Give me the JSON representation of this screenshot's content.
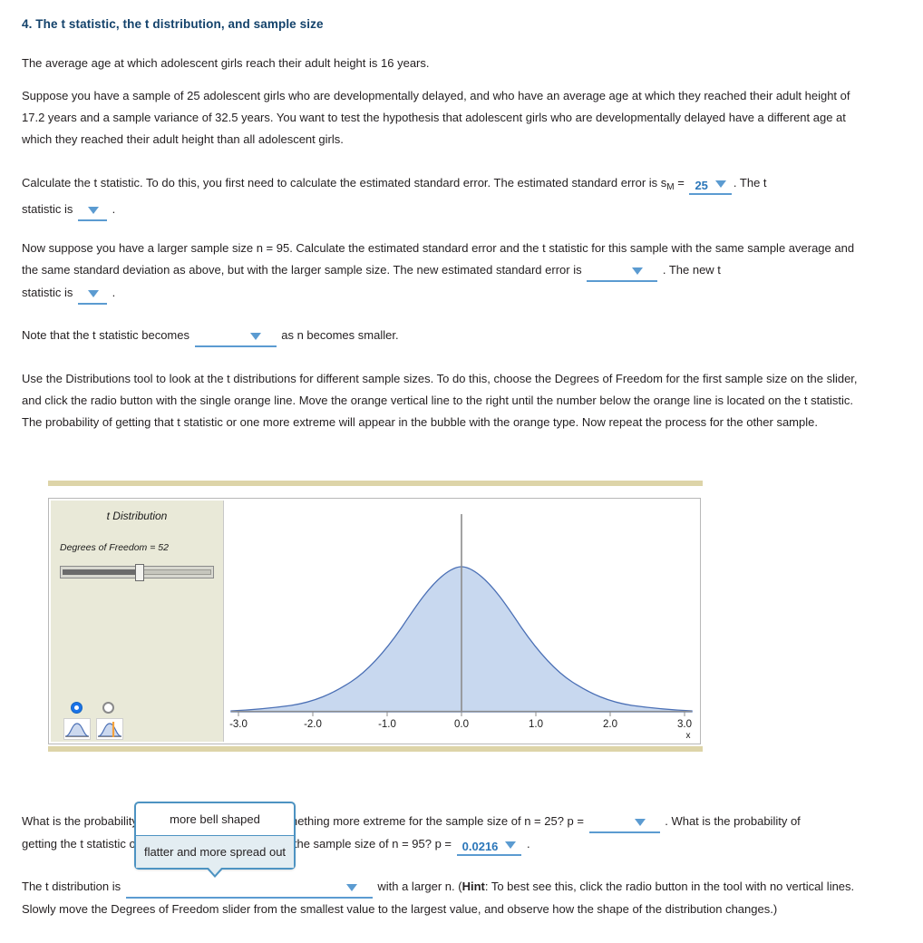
{
  "question": {
    "title": "4. The t statistic, the t distribution, and sample size"
  },
  "paragraphs": {
    "p1": "The average age at which adolescent girls reach their adult height is 16 years.",
    "p2": "Suppose you have a sample of 25 adolescent girls who are developmentally delayed, and who have an average age at which they reached their adult height of 17.2 years and a sample variance of 32.5 years. You want to test the hypothesis that adolescent girls who are developmentally delayed have a different age at which they reached their adult height than all adolescent girls.",
    "p3_a": "Calculate the t statistic. To do this, you first need to calculate the estimated standard error. The estimated standard error is s",
    "p3_sub": "M",
    "p3_b": " = ",
    "p3_c": ". The t",
    "p3_d": "statistic is",
    "p3_e": ".",
    "p4_a": "Now suppose you have a larger sample size n = 95. Calculate the estimated standard error and the t statistic for this sample with the same sample average and the same standard deviation as above, but with the larger sample size. The new estimated standard error is",
    "p4_b": ". The new t",
    "p4_c": "statistic is",
    "p4_d": ".",
    "p5_a": "Note that the t statistic becomes",
    "p5_b": "as n becomes smaller.",
    "p6": "Use the Distributions tool to look at the t distributions for different sample sizes. To do this, choose the Degrees of Freedom for the first sample size on the slider, and click the radio button with the single orange line. Move the orange vertical line to the right until the number below the orange line is located on the t statistic. The probability of getting that t statistic or one more extreme will appear in the bubble with the orange type. Now repeat the process for the other sample.",
    "p7_a": "What is the probability of getting the t statistic or something more extreme for the sample size of n = 25? p = ",
    "p7_b": ". What is the probability of",
    "p7_c": "getting the t statistic or something more extreme for the sample size of n = 95? p = ",
    "p7_d": ".",
    "p8_a": "The t distribution is",
    "p8_b": "with a larger n. (",
    "p8_hint": "Hint",
    "p8_c": ": To best see this, click the radio button in the tool with no vertical lines.",
    "p8_d": "Slowly move the Degrees of Freedom slider from the smallest value to the largest value, and observe how the shape of the distribution changes.)"
  },
  "dropdowns": {
    "standard_error_1": {
      "value": "25",
      "filled": true
    },
    "t_statistic_1": {
      "value": "",
      "filled": false
    },
    "standard_error_2": {
      "value": "",
      "filled": false
    },
    "t_statistic_2": {
      "value": "",
      "filled": false
    },
    "t_becomes": {
      "value": "",
      "filled": false
    },
    "p_value_n25": {
      "value": "",
      "filled": false
    },
    "p_value_n95": {
      "value": "0.0216",
      "filled": true
    },
    "t_distribution_shape": {
      "value": "",
      "filled": false
    }
  },
  "open_menu": {
    "options": [
      {
        "label": "more bell shaped",
        "selected": false
      },
      {
        "label": "flatter and more spread out",
        "selected": true
      }
    ]
  },
  "tool": {
    "title": "t Distribution",
    "dof_label": "Degrees of Freedom = 52",
    "dof_value": 52,
    "slider_percent": 50,
    "radio_selected_index": 0,
    "radio_options": [
      {
        "name": "curve-no-line"
      },
      {
        "name": "curve-with-orange-line"
      }
    ]
  },
  "chart_data": {
    "type": "area",
    "title": "t Distribution",
    "xlabel": "x",
    "ylabel": "",
    "xlim": [
      -3.2,
      3.2
    ],
    "ylim": [
      0,
      0.4
    ],
    "grid": false,
    "legend": null,
    "tick_labels": [
      "-3.0",
      "-2.0",
      "-1.0",
      "0.0",
      "1.0",
      "2.0",
      "3.0"
    ],
    "ticks": [
      -3.0,
      -2.0,
      -1.0,
      0.0,
      1.0,
      2.0,
      3.0
    ],
    "df": 52,
    "fill_color": "#c8d8ef",
    "line_color": "#4a6fb5",
    "vertical_line": {
      "x": 0.0,
      "color": "#8c8c8c"
    },
    "x": [
      -3.2,
      -3.0,
      -2.8,
      -2.6,
      -2.4,
      -2.2,
      -2.0,
      -1.8,
      -1.6,
      -1.4,
      -1.2,
      -1.0,
      -0.8,
      -0.6,
      -0.4,
      -0.2,
      0.0,
      0.2,
      0.4,
      0.6,
      0.8,
      1.0,
      1.2,
      1.4,
      1.6,
      1.8,
      2.0,
      2.2,
      2.4,
      2.6,
      2.8,
      3.0,
      3.2
    ],
    "y": [
      0.0033,
      0.005,
      0.0075,
      0.011,
      0.0158,
      0.0221,
      0.0303,
      0.0406,
      0.0531,
      0.0678,
      0.0844,
      0.1023,
      0.1206,
      0.1383,
      0.1543,
      0.1673,
      0.1764,
      0.1673,
      0.1543,
      0.1383,
      0.1206,
      0.1023,
      0.0844,
      0.0678,
      0.0531,
      0.0406,
      0.0303,
      0.0221,
      0.0158,
      0.011,
      0.0075,
      0.005,
      0.0033
    ]
  },
  "colors": {
    "title": "#13426b",
    "link": "#2b76b9",
    "dropdown_underline": "#5b9bd1",
    "rule": "#ddd4a8",
    "panel_bg": "#e9e9d8",
    "menu_border": "#4d93c2",
    "menu_selected_bg": "#e3edf2",
    "curve_fill": "#c8d8ef",
    "curve_line": "#4a6fb5",
    "orange": "#f5a23c"
  }
}
